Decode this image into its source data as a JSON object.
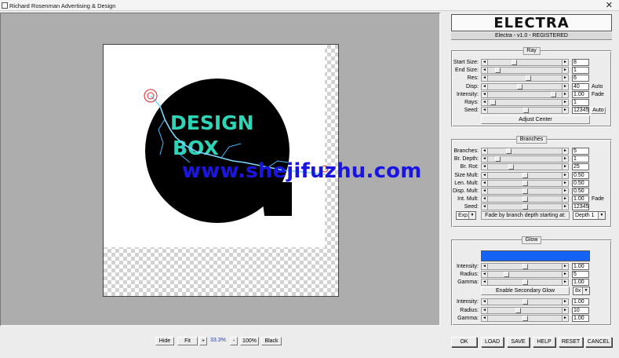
{
  "window": {
    "title": "Richard Rosenman Advertising & Design",
    "close_glyph": "✕"
  },
  "preview": {
    "artwork_lines": [
      "DESIGN",
      "BOX"
    ],
    "watermark": "www.shejifuzhu.com",
    "colors": {
      "circle": "#000000",
      "text": "#2fd3b6",
      "lightning": "#7fd8ff",
      "marker": "#e0242a",
      "watermark": "#1a15e0"
    }
  },
  "viewbar": {
    "hide": "Hide",
    "fit": "Fit",
    "plus": "+",
    "zoom": "33.3%",
    "minus": "-",
    "full": "100%",
    "black": "Black"
  },
  "plugin": {
    "logo": "ELECTRA",
    "version": "Electra - v1.0 - REGISTERED"
  },
  "ray": {
    "title": "Ray",
    "rows": [
      {
        "label": "Start Size:",
        "value": "8",
        "pos": 0.35
      },
      {
        "label": "End Size:",
        "value": "1",
        "pos": 0.1
      },
      {
        "label": "Res:",
        "value": "6",
        "pos": 0.55
      },
      {
        "label": "Disp:",
        "value": "40",
        "pos": 0.42,
        "tail": "Auto"
      },
      {
        "label": "Intensity:",
        "value": "1.00",
        "pos": 0.92,
        "tail": "Fade"
      },
      {
        "label": "Rays:",
        "value": "1",
        "pos": 0.03
      },
      {
        "label": "Seed:",
        "value": "12345",
        "pos": 0.52,
        "tailbtn": "Auto"
      }
    ],
    "adjust_center": "Adjust Center"
  },
  "branches": {
    "title": "Branches",
    "rows": [
      {
        "label": "Branches:",
        "value": "5",
        "pos": 0.26
      },
      {
        "label": "Br. Depth:",
        "value": "1",
        "pos": 0.1
      },
      {
        "label": "Br. Rot:",
        "value": "25",
        "pos": 0.3
      },
      {
        "label": "Size Mult:",
        "value": "0.50",
        "pos": 0.5
      },
      {
        "label": "Len. Mult:",
        "value": "0.50",
        "pos": 0.5
      },
      {
        "label": "Disp. Mult:",
        "value": "0.50",
        "pos": 0.5
      },
      {
        "label": "Int. Mult:",
        "value": "1.00",
        "pos": 0.5,
        "tail": "Fade"
      },
      {
        "label": "Seed:",
        "value": "12345",
        "pos": 0.5
      }
    ],
    "exp_select": "Exp.",
    "fade_label": "Fade by branch depth starting at:",
    "depth_select": "Depth 1"
  },
  "glow": {
    "title": "Glow",
    "color": "#1463f5",
    "primary_rows": [
      {
        "label": "Intensity:",
        "value": "1.00",
        "pos": 0.5
      },
      {
        "label": "Radius:",
        "value": "5",
        "pos": 0.23
      },
      {
        "label": "Gamma:",
        "value": "1.00",
        "pos": 0.5
      }
    ],
    "secondary_button": "Enable Secondary Glow",
    "secondary_select": "8x",
    "secondary_rows": [
      {
        "label": "Intensity:",
        "value": "1.00",
        "pos": 0.5
      },
      {
        "label": "Radius:",
        "value": "10",
        "pos": 0.4
      },
      {
        "label": "Gamma:",
        "value": "1.00",
        "pos": 0.5
      }
    ]
  },
  "actions": {
    "ok": "OK",
    "load": "LOAD",
    "save": "SAVE",
    "help": "HELP",
    "reset": "RESET",
    "cancel": "CANCEL"
  }
}
